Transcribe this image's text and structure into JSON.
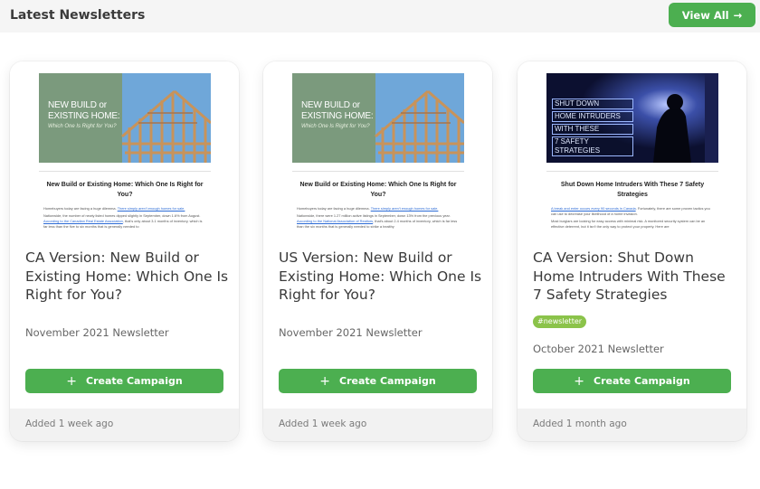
{
  "header": {
    "title": "Latest Newsletters",
    "view_all": "View All",
    "arrow": "→"
  },
  "cards": [
    {
      "hero_line1": "NEW BUILD or",
      "hero_line2": "EXISTING HOME:",
      "hero_sub": "Which One Is Right for You?",
      "preview_title": "New Build or Existing Home: Which One Is Right for You?",
      "preview_p1_text": "Homebuyers today are facing a huge dilemma. ",
      "preview_p1_link": "There simply aren't enough homes for sale.",
      "preview_p2_text": "Nationwide, the number of newly listed homes dipped slightly in September, down 1.6% from August. ",
      "preview_p2_link": "According to the Canadian Real Estate Association",
      "preview_p2_tail": ", that's only about 3.1 months of inventory, which is far less than the five to six months that is generally needed to",
      "title": "CA Version: New Build or Existing Home: Which One Is Right for You?",
      "tag": "",
      "subtitle": "November 2021 Newsletter",
      "button": "Create Campaign",
      "added": "Added 1 week ago"
    },
    {
      "hero_line1": "NEW BUILD or",
      "hero_line2": "EXISTING HOME:",
      "hero_sub": "Which One Is Right for You?",
      "preview_title": "New Build or Existing Home: Which One Is Right for You?",
      "preview_p1_text": "Homebuyers today are facing a huge dilemma. ",
      "preview_p1_link": "There simply aren't enough homes for sale.",
      "preview_p2_text": "Nationwide, there were 1.27 million active listings in September, down 13% from the previous year. ",
      "preview_p2_link": "According to the National Association of Realtors",
      "preview_p2_tail": ", that's about 2.4 months of inventory, which is far less than the six months that is generally needed to strike a healthy",
      "title": "US Version: New Build or Existing Home: Which One Is Right for You?",
      "tag": "",
      "subtitle": "November 2021 Newsletter",
      "button": "Create Campaign",
      "added": "Added 1 week ago"
    },
    {
      "hero_lines": [
        "SHUT DOWN",
        "HOME INTRUDERS",
        "WITH THESE",
        "7 SAFETY STRATEGIES"
      ],
      "preview_title": "Shut Down Home Intruders With These 7 Safety Strategies",
      "preview_p1_link": "A break and enter occurs every 90 seconds in Canada",
      "preview_p1_text": ". Fortunately, there are some proven tactics you can use to decrease your likelihood of a home invasion.",
      "preview_p2_text": "Most burglars are looking for easy access with minimal risk. A monitored security system can be an effective deterrent, but it isn't the only way to protect your property. Here are",
      "title": "CA Version: Shut Down Home Intruders With These 7 Safety Strategies",
      "tag": "#newsletter",
      "subtitle": "October 2021 Newsletter",
      "button": "Create Campaign",
      "added": "Added 1 month ago"
    }
  ],
  "icons": {
    "arrow": "arrow-right-icon",
    "plus": "plus-icon"
  },
  "colors": {
    "accent": "#4caf50",
    "tag": "#8bc34a",
    "hero_green": "#7b9a7d",
    "hero_sky": "#6fa7d9",
    "hero_dark": "#0c1030"
  }
}
